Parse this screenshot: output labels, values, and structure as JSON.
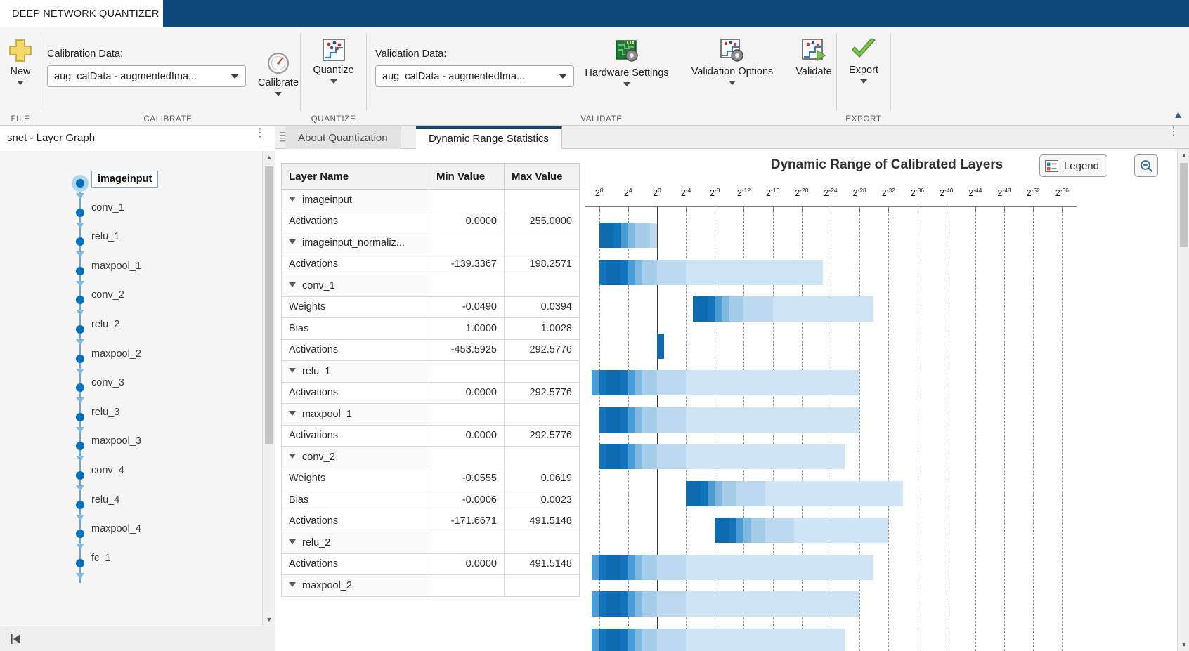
{
  "window": {
    "title": "DEEP NETWORK QUANTIZER"
  },
  "ribbon": {
    "sections": [
      {
        "name": "FILE",
        "footer": "FILE"
      },
      {
        "name": "CALIBRATE",
        "footer": "CALIBRATE"
      },
      {
        "name": "QUANTIZE",
        "footer": "QUANTIZE"
      },
      {
        "name": "VALIDATE",
        "footer": "VALIDATE"
      },
      {
        "name": "EXPORT",
        "footer": "EXPORT"
      }
    ],
    "new_label": "New",
    "calibration_data_label": "Calibration Data:",
    "calibration_data_value": "aug_calData - augmentedIma...",
    "calibrate_label": "Calibrate",
    "quantize_label": "Quantize",
    "validation_data_label": "Validation Data:",
    "validation_data_value": "aug_calData - augmentedIma...",
    "hardware_settings_label": "Hardware Settings",
    "validation_options_label": "Validation Options",
    "validate_label": "Validate",
    "export_label": "Export"
  },
  "left_panel": {
    "title": "snet - Layer Graph",
    "overflow_icon": "vertical-dots-icon",
    "nodes": [
      {
        "label": "imageinput",
        "selected": true
      },
      {
        "label": "conv_1",
        "selected": false
      },
      {
        "label": "relu_1",
        "selected": false
      },
      {
        "label": "maxpool_1",
        "selected": false
      },
      {
        "label": "conv_2",
        "selected": false
      },
      {
        "label": "relu_2",
        "selected": false
      },
      {
        "label": "maxpool_2",
        "selected": false
      },
      {
        "label": "conv_3",
        "selected": false
      },
      {
        "label": "relu_3",
        "selected": false
      },
      {
        "label": "maxpool_3",
        "selected": false
      },
      {
        "label": "conv_4",
        "selected": false
      },
      {
        "label": "relu_4",
        "selected": false
      },
      {
        "label": "maxpool_4",
        "selected": false
      },
      {
        "label": "fc_1",
        "selected": false
      }
    ],
    "footer_icon": "skip-to-start-icon"
  },
  "main": {
    "tabs": [
      {
        "label": "About Quantization",
        "active": false
      },
      {
        "label": "Dynamic Range Statistics",
        "active": true
      }
    ],
    "overflow_icon": "vertical-dots-icon",
    "table": {
      "columns": [
        "Layer Name",
        "Min Value",
        "Max Value"
      ],
      "rows": [
        {
          "type": "group",
          "name": "imageinput",
          "min": "",
          "max": ""
        },
        {
          "type": "child",
          "name": "Activations",
          "min": "0.0000",
          "max": "255.0000"
        },
        {
          "type": "group",
          "name": "imageinput_normaliz...",
          "min": "",
          "max": ""
        },
        {
          "type": "child",
          "name": "Activations",
          "min": "-139.3367",
          "max": "198.2571"
        },
        {
          "type": "group",
          "name": "conv_1",
          "min": "",
          "max": ""
        },
        {
          "type": "child",
          "name": "Weights",
          "min": "-0.0490",
          "max": "0.0394"
        },
        {
          "type": "child",
          "name": "Bias",
          "min": "1.0000",
          "max": "1.0028"
        },
        {
          "type": "child",
          "name": "Activations",
          "min": "-453.5925",
          "max": "292.5776"
        },
        {
          "type": "group",
          "name": "relu_1",
          "min": "",
          "max": ""
        },
        {
          "type": "child",
          "name": "Activations",
          "min": "0.0000",
          "max": "292.5776"
        },
        {
          "type": "group",
          "name": "maxpool_1",
          "min": "",
          "max": ""
        },
        {
          "type": "child",
          "name": "Activations",
          "min": "0.0000",
          "max": "292.5776"
        },
        {
          "type": "group",
          "name": "conv_2",
          "min": "",
          "max": ""
        },
        {
          "type": "child",
          "name": "Weights",
          "min": "-0.0555",
          "max": "0.0619"
        },
        {
          "type": "child",
          "name": "Bias",
          "min": "-0.0006",
          "max": "0.0023"
        },
        {
          "type": "child",
          "name": "Activations",
          "min": "-171.6671",
          "max": "491.5148"
        },
        {
          "type": "group",
          "name": "relu_2",
          "min": "",
          "max": ""
        },
        {
          "type": "child",
          "name": "Activations",
          "min": "0.0000",
          "max": "491.5148"
        },
        {
          "type": "group",
          "name": "maxpool_2",
          "min": "",
          "max": ""
        }
      ]
    },
    "chart_header": {
      "title": "Dynamic Range of Calibrated Layers",
      "legend_label": "Legend",
      "legend_icon": "legend-icon",
      "zoom_icon": "zoom-out-icon"
    }
  },
  "chart_data": {
    "type": "bar",
    "title": "Dynamic Range of Calibrated Layers",
    "xlabel": "",
    "ylabel": "",
    "grid": true,
    "legend_position": "top-right",
    "x_tick_labels": [
      "2^8",
      "2^4",
      "2^0",
      "2^-4",
      "2^-8",
      "2^-12",
      "2^-16",
      "2^-20",
      "2^-24",
      "2^-28",
      "2^-32",
      "2^-36",
      "2^-40",
      "2^-44",
      "2^-48",
      "2^-52",
      "2^-56"
    ],
    "x_tick_exponents": [
      8,
      4,
      0,
      -4,
      -8,
      -12,
      -16,
      -20,
      -24,
      -28,
      -32,
      -36,
      -40,
      -44,
      -48,
      -52,
      -56
    ],
    "zero_exponent_line": 0,
    "colors": {
      "segment_darkest": "#1275bc",
      "segment_mid": "#60a6d8",
      "segment_light": "#a8d0ea",
      "segment_lightest": "#c5e0f2",
      "gridline": "#8c8c8c",
      "zeroline": "#3a3a3a",
      "accent": "#0b4778"
    },
    "series": [
      {
        "name": "imageinput/Activations",
        "start_exp": 8,
        "end_exp": 0,
        "peak_exp": 7
      },
      {
        "name": "imageinput_normaliz.../Activations",
        "start_exp": 8,
        "end_exp": -23,
        "peak_exp": 6
      },
      {
        "name": "conv_1/Weights",
        "start_exp": -5,
        "end_exp": -30,
        "peak_exp": -6
      },
      {
        "name": "conv_1/Bias",
        "start_exp": 0,
        "end_exp": -1,
        "peak_exp": 0
      },
      {
        "name": "conv_1/Activations",
        "start_exp": 9,
        "end_exp": -28,
        "peak_exp": 6
      },
      {
        "name": "relu_1/Activations",
        "start_exp": 8,
        "end_exp": -28,
        "peak_exp": 6
      },
      {
        "name": "maxpool_1/Activations",
        "start_exp": 8,
        "end_exp": -26,
        "peak_exp": 6
      },
      {
        "name": "conv_2/Weights",
        "start_exp": -4,
        "end_exp": -34,
        "peak_exp": -5
      },
      {
        "name": "conv_2/Bias",
        "start_exp": -8,
        "end_exp": -32,
        "peak_exp": -9
      },
      {
        "name": "conv_2/Activations",
        "start_exp": 9,
        "end_exp": -30,
        "peak_exp": 6
      },
      {
        "name": "relu_2/Activations",
        "start_exp": 9,
        "end_exp": -28,
        "peak_exp": 6
      },
      {
        "name": "maxpool_2/Activations",
        "start_exp": 9,
        "end_exp": -26,
        "peak_exp": 6
      }
    ]
  }
}
